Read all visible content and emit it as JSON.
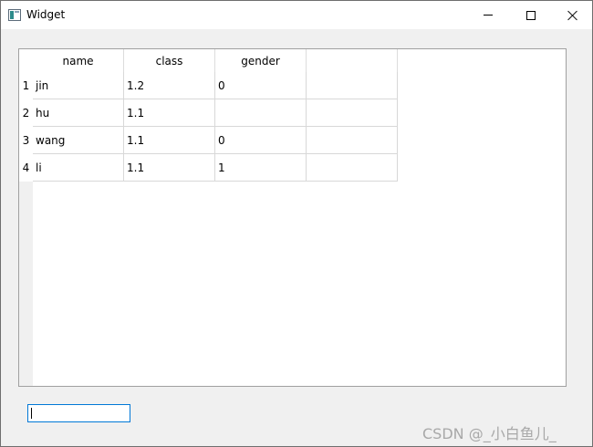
{
  "window": {
    "title": "Widget"
  },
  "table": {
    "headers": [
      "name",
      "class",
      "gender",
      ""
    ],
    "row_labels": [
      "1",
      "2",
      "3",
      "4"
    ],
    "rows": [
      [
        "jin",
        "1.2",
        "0",
        ""
      ],
      [
        "hu",
        "1.1",
        "",
        ""
      ],
      [
        "wang",
        "1.1",
        "0",
        ""
      ],
      [
        "li",
        "1.1",
        "1",
        ""
      ]
    ]
  },
  "input": {
    "value": ""
  },
  "watermark": "CSDN @_小白鱼儿_",
  "colors": {
    "focus_border": "#0078d7",
    "frame": "#a0a0a0"
  }
}
